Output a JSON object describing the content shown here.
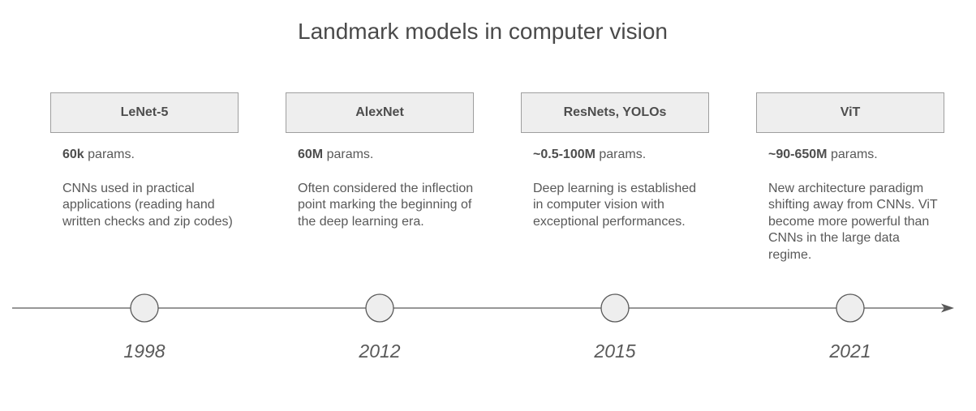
{
  "title": "Landmark models in computer vision",
  "milestones": [
    {
      "name": "LeNet-5",
      "params_value": "60k",
      "params_suffix": " params.",
      "description": "CNNs used in practical applications (reading hand written checks and zip codes)",
      "year": "1998"
    },
    {
      "name": "AlexNet",
      "params_value": "60M",
      "params_suffix": " params.",
      "description": "Often considered the inflection point marking the beginning of the deep learning era.",
      "year": "2012"
    },
    {
      "name": "ResNets, YOLOs",
      "params_value": "~0.5-100M",
      "params_suffix": " params.",
      "description": "Deep learning is established in computer vision with exceptional performances.",
      "year": "2015"
    },
    {
      "name": "ViT",
      "params_value": "~90-650M",
      "params_suffix": " params.",
      "description": "New architecture paradigm shifting away from CNNs. ViT become more powerful than CNNs in the large data regime.",
      "year": "2021"
    }
  ],
  "colors": {
    "line": "#595959",
    "node_fill": "#eeeeee",
    "node_stroke": "#595959",
    "card_fill": "#eeeeee",
    "card_stroke": "#9e9e9e"
  }
}
